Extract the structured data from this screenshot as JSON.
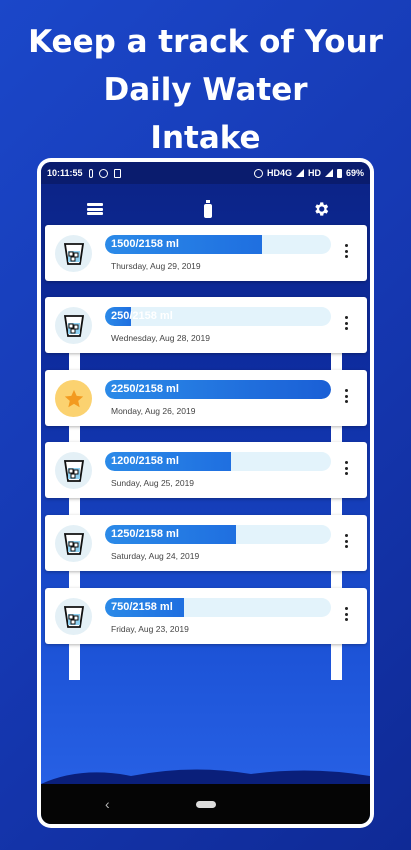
{
  "headline": {
    "line1": "Keep a track of Your",
    "line2": "Daily Water",
    "line3": "Intake"
  },
  "status_bar": {
    "time": "10:11:55",
    "network": "HD4G",
    "network2": "HD",
    "battery": "69%"
  },
  "toolbar": {
    "left_icon": "list-icon",
    "center_icon": "bottle-icon",
    "right_icon": "gear-icon"
  },
  "entries": [
    {
      "intake": "1500/2158 ml",
      "date": "Thursday, Aug 29, 2019",
      "progress": 0.695,
      "icon": "glass-icon"
    },
    {
      "intake": "250/2158 ml",
      "date": "Wednesday, Aug 28, 2019",
      "progress": 0.116,
      "icon": "glass-icon"
    },
    {
      "intake": "2250/2158 ml",
      "date": "Monday, Aug 26, 2019",
      "progress": 1.0,
      "icon": "star-icon"
    },
    {
      "intake": "1200/2158 ml",
      "date": "Sunday, Aug 25, 2019",
      "progress": 0.556,
      "icon": "glass-icon"
    },
    {
      "intake": "1250/2158 ml",
      "date": "Saturday, Aug 24, 2019",
      "progress": 0.579,
      "icon": "glass-icon"
    },
    {
      "intake": "750/2158 ml",
      "date": "Friday, Aug 23, 2019",
      "progress": 0.348,
      "icon": "glass-icon"
    }
  ],
  "nav": {
    "back_glyph": "‹"
  },
  "colors": {
    "background": "#1b47c9",
    "accent": "#2b8ae8",
    "track": "#e3f3fb",
    "star": "#fbd270"
  }
}
